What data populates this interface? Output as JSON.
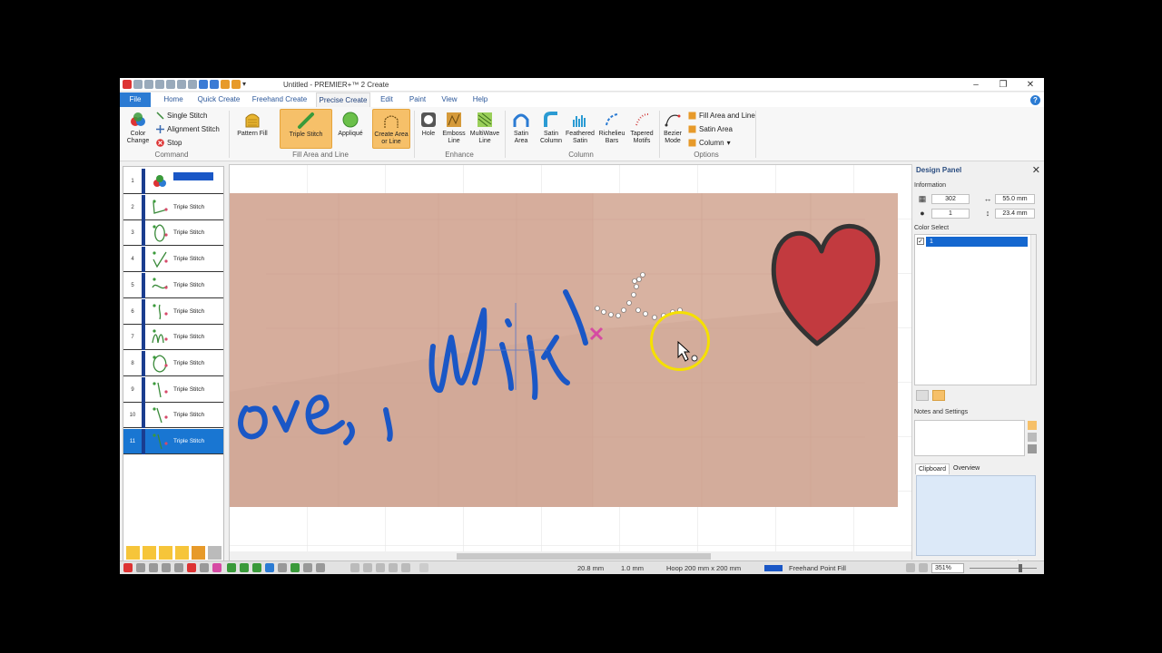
{
  "window": {
    "title": "Untitled - PREMIER+™ 2 Create",
    "controls": {
      "minimize": "–",
      "restore": "❐",
      "close": "✕"
    }
  },
  "tabs": [
    "File",
    "Home",
    "Quick Create",
    "Freehand Create",
    "Precise Create",
    "Edit",
    "Paint",
    "View",
    "Help"
  ],
  "active_tab": "Precise Create",
  "help_label": "?",
  "ribbon": {
    "command": {
      "color_change": "Color Change",
      "single_stitch": "Single Stitch",
      "alignment_stitch": "Alignment Stitch",
      "stop": "Stop",
      "group": "Command"
    },
    "fill_area_and_line": {
      "pattern_fill": "Pattern Fill",
      "triple_stitch": "Triple Stitch",
      "applique": "Appliqué",
      "create_area_or_line": "Create Area or Line",
      "group": "Fill Area and Line"
    },
    "enhance": {
      "hole": "Hole",
      "emboss_line": "Emboss Line",
      "multiwave_line": "MultiWave Line",
      "group": "Enhance"
    },
    "column": {
      "satin_area": "Satin Area",
      "satin_column": "Satin Column",
      "feathered_satin": "Feathered Satin",
      "richelieu_bars": "Richelieu Bars",
      "tapered_motifs": "Tapered Motifs",
      "group": "Column"
    },
    "options": {
      "bezier_mode": "Bezier Mode",
      "fill_area_and_line": "Fill Area and Line",
      "satin_area": "Satin Area",
      "column": "Column",
      "group": "Options"
    }
  },
  "sequence": {
    "items": [
      {
        "num": "1",
        "label": "",
        "swatch": "#1a57c6"
      },
      {
        "num": "2",
        "label": "Triple Stitch"
      },
      {
        "num": "3",
        "label": "Triple Stitch"
      },
      {
        "num": "4",
        "label": "Triple Stitch"
      },
      {
        "num": "5",
        "label": "Triple Stitch"
      },
      {
        "num": "6",
        "label": "Triple Stitch"
      },
      {
        "num": "7",
        "label": "Triple Stitch"
      },
      {
        "num": "8",
        "label": "Triple Stitch"
      },
      {
        "num": "9",
        "label": "Triple Stitch"
      },
      {
        "num": "10",
        "label": "Triple Stitch"
      },
      {
        "num": "11",
        "label": "Triple Stitch"
      }
    ],
    "selected": "11"
  },
  "design_panel": {
    "title": "Design Panel",
    "information": "Information",
    "stitches": "302",
    "width": "55.0 mm",
    "colors": "1",
    "height": "23.4 mm",
    "color_select": "Color Select",
    "color_item": "1",
    "thread_color": "#1467cf",
    "notes_and_settings": "Notes and Settings",
    "clipboard_tab": "Clipboard",
    "overview_tab": "Overview"
  },
  "status": {
    "x": "20.8 mm",
    "y": "1.0 mm",
    "hoop": "Hoop 200 mm x 200 mm",
    "mode": "Freehand Point Fill",
    "zoom": "351%"
  },
  "colors": {
    "accent": "#2b7bd3",
    "selection": "#1976d2",
    "stitch_blue": "#1a57c6",
    "heart_red": "#c23a3f",
    "fabric": "#d6ad9c",
    "highlight": "#f6c069"
  }
}
